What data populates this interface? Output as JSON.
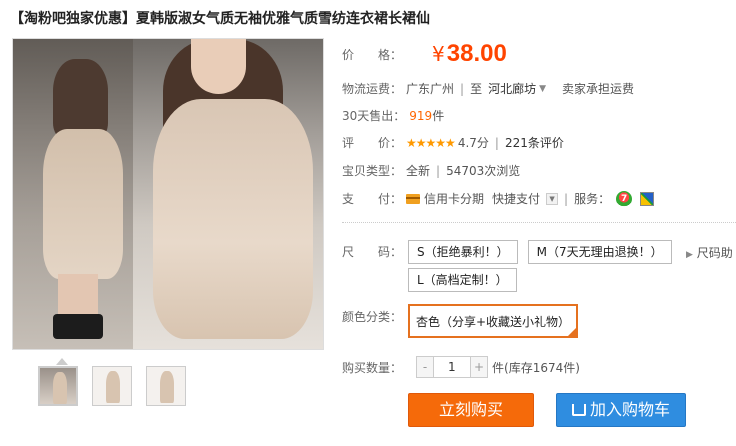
{
  "title": "【淘粉吧独家优惠】夏韩版淑女气质无袖优雅气质雪纺连衣裙长裙仙",
  "price": {
    "label": "价　　格：",
    "currency": "¥",
    "value": "38.00"
  },
  "shipping": {
    "label": "物流运费：",
    "from": "广东广州",
    "to_prefix": "至",
    "to": "河北廊坊",
    "fee": "卖家承担运费"
  },
  "sold": {
    "label": "30天售出：",
    "count": "919",
    "unit": "件"
  },
  "rating": {
    "label": "评　　价：",
    "stars": "★★★★★",
    "score": "4.7分",
    "reviews": "221条评价"
  },
  "item_type": {
    "label": "宝贝类型：",
    "condition": "全新",
    "views": "54703次浏览"
  },
  "payment": {
    "label": "支　　付：",
    "method1": "信用卡分期",
    "method2": "快捷支付",
    "service_label": "服务："
  },
  "size": {
    "label": "尺　　码：",
    "options": [
      "S（拒绝暴利！）",
      "M（7天无理由退换！）",
      "L（高档定制！）"
    ],
    "more": "尺码助"
  },
  "color": {
    "label": "颜色分类：",
    "selected": "杏色（分享+收藏送小礼物）"
  },
  "quantity": {
    "label": "购买数量：",
    "minus": "-",
    "plus": "+",
    "value": "1",
    "unit": "件",
    "stock": "(库存1674件)"
  },
  "buttons": {
    "buy": "立刻购买",
    "cart": "加入购物车"
  },
  "colors": {
    "accent": "#ff4400",
    "buy": "#f56a0a",
    "cart": "#2f8de0"
  }
}
